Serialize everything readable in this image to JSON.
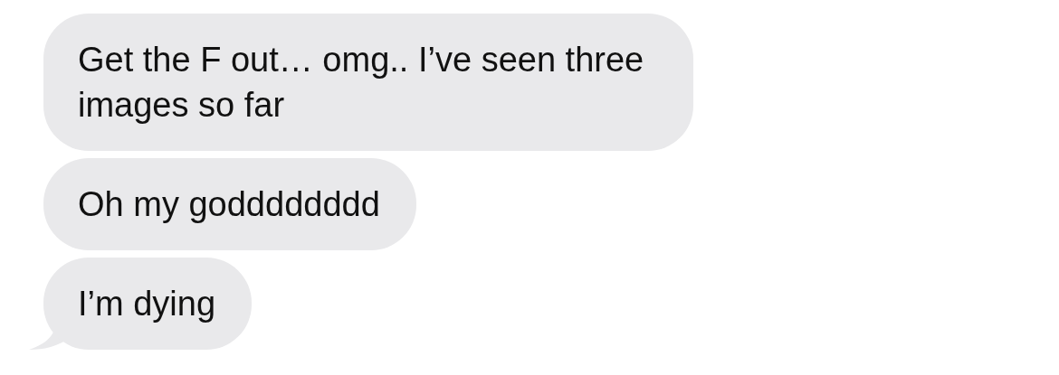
{
  "messages": [
    {
      "text": "Get the F out… omg.. I’ve seen three images so far",
      "tail": false
    },
    {
      "text": "Oh my godddddddd",
      "tail": false
    },
    {
      "text": "I’m dying",
      "tail": true
    }
  ]
}
